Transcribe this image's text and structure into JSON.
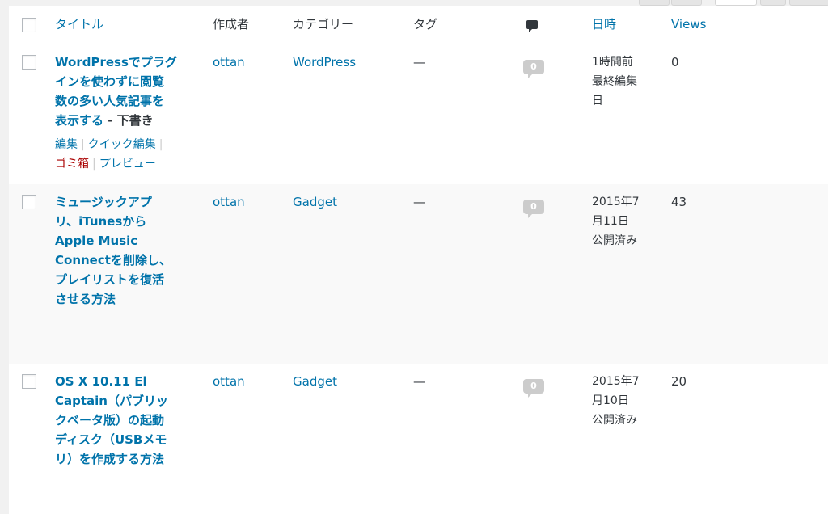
{
  "header": {
    "title": "タイトル",
    "author": "作成者",
    "categories": "カテゴリー",
    "tags": "タグ",
    "comments_icon": "comment-bubble-icon",
    "date": "日時",
    "views": "Views"
  },
  "posts": [
    {
      "title_lines": [
        "WordPressでプラグ",
        "インを使わずに閲覧",
        "数の多い人気記事を",
        "表示する"
      ],
      "state": " - 下書き",
      "author": "ottan",
      "category": "WordPress",
      "tags": "—",
      "comments": "0",
      "date_lines": [
        "1時間前",
        "最終編集",
        "日"
      ],
      "views": "0",
      "row_actions": {
        "edit": "編集",
        "quick_edit": "クイック編集",
        "trash": "ゴミ箱",
        "preview": "プレビュー"
      }
    },
    {
      "title_lines": [
        "ミュージックアプ",
        "リ、iTunesから",
        "Apple Music",
        "Connectを削除し、",
        "プレイリストを復活",
        "させる方法"
      ],
      "author": "ottan",
      "category": "Gadget",
      "tags": "—",
      "comments": "0",
      "date_lines": [
        "2015年7",
        "月11日",
        "公開済み"
      ],
      "views": "43"
    },
    {
      "title_lines": [
        "OS X 10.11 El",
        "Captain（パブリッ",
        "クベータ版）の起動",
        "ディスク（USBメモ",
        "リ）を作成する方法"
      ],
      "author": "ottan",
      "category": "Gadget",
      "tags": "—",
      "comments": "0",
      "date_lines": [
        "2015年7",
        "月10日",
        "公開済み"
      ],
      "views": "20"
    }
  ]
}
